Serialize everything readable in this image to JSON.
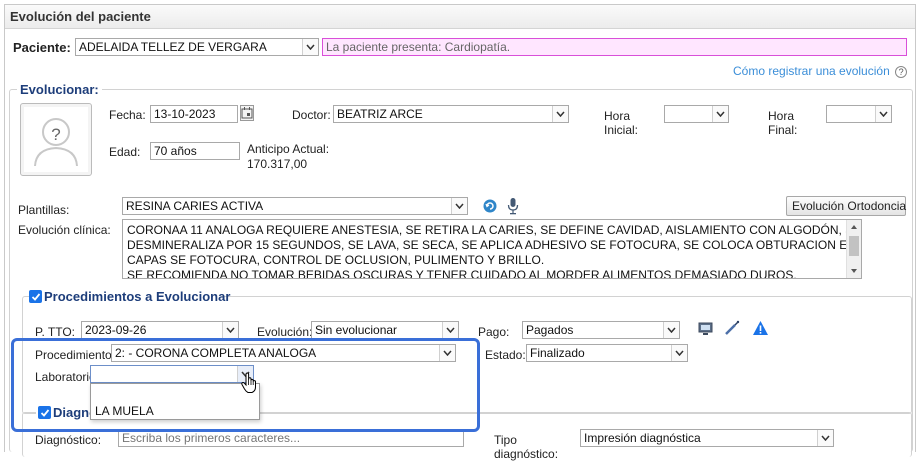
{
  "window": {
    "title": "Evolución del paciente"
  },
  "patient": {
    "label": "Paciente:",
    "name": "ADELAIDA  TELLEZ DE VERGARA",
    "alert": "La paciente presenta: Cardiopatía."
  },
  "help_link": "Cómo registrar una evolución",
  "evolucionar": {
    "legend": "Evolucionar:",
    "fecha_label": "Fecha:",
    "fecha_value": "13-10-2023",
    "doctor_label": "Doctor:",
    "doctor_value": "BEATRIZ ARCE",
    "hora_inicial_line1": "Hora",
    "hora_inicial_line2": "Inicial:",
    "hora_final_line1": "Hora",
    "hora_final_line2": "Final:",
    "edad_label": "Edad:",
    "edad_value": "70 años",
    "anticipo_label": "Anticipo Actual:",
    "anticipo_value": "170.317,00",
    "plantillas_label": "Plantillas:",
    "plantillas_value": "RESINA CARIES ACTIVA",
    "ortodoncia_button": "Evolución Ortodoncia",
    "evolucion_label": "Evolución clínica:",
    "evolucion_lines": [
      "CORONAA 11 ANALOGA  REQUIERE ANESTESIA, SE RETIRA LA CARIES,  SE DEFINE CAVIDAD, AISLAMIENTO CON ALGODÓN, SE",
      "DESMINERALIZA POR 15 SEGUNDOS, SE LAVA, SE SECA, SE APLICA ADHESIVO SE FOTOCURA, SE COLOCA OBTURACION EN RESINA EN",
      "CAPAS SE FOTOCURA, CONTROL DE OCLUSION, PULIMENTO Y BRILLO.",
      "SE RECOMIENDA NO TOMAR BEBIDAS OSCURAS Y TENER CUIDADO AL MORDER ALIMENTOS DEMASIADO DUROS."
    ]
  },
  "procedimientos": {
    "legend": "Procedimientos a Evolucionar",
    "ptto_label": "P. TTO:",
    "ptto_value": "2023-09-26",
    "evolucion_label": "Evolución:",
    "evolucion_value": "Sin evolucionar",
    "pago_label": "Pago:",
    "pago_value": "Pagados",
    "procedimiento_label": "Procedimiento:",
    "procedimiento_value": "2:  - CORONA COMPLETA ANALOGA",
    "estado_label": "Estado:",
    "estado_value": "Finalizado",
    "laboratorio_label": "Laboratorio",
    "laboratorio_value": "",
    "laboratorio_options": [
      "LA MUELA"
    ]
  },
  "diagnostico": {
    "legend": "Diagnó",
    "label": "Diagnóstico:",
    "placeholder": "Escriba los primeros caracteres...",
    "tipo_line1": "Tipo",
    "tipo_line2": "diagnóstico:",
    "tipo_value": "Impresión diagnóstica"
  },
  "colors": {
    "accent": "#1a73e8",
    "legend": "#1d3d7a",
    "alert_bg": "#ffe6ff",
    "alert_border": "#d94fd9",
    "link": "#3b8ed8",
    "highlight": "#3a6fd8"
  }
}
